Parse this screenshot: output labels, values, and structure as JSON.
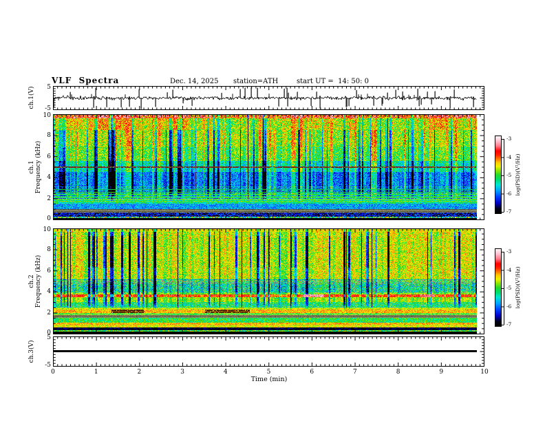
{
  "header": {
    "title": "VLF  Spectra",
    "date": "Dec. 14, 2025",
    "station": "station=ATH",
    "start_ut": "start UT =  14: 50: 0"
  },
  "axes": {
    "x": {
      "title": "Time (min)",
      "ticks": [
        "0",
        "1",
        "2",
        "3",
        "4",
        "5",
        "6",
        "7",
        "8",
        "9",
        "10"
      ],
      "tick_values": [
        0,
        1,
        2,
        3,
        4,
        5,
        6,
        7,
        8,
        9,
        10
      ],
      "range": [
        0,
        10
      ]
    },
    "wave1": {
      "label": "ch.1(V)",
      "ticks": [
        "5",
        "-5"
      ],
      "tick_values": [
        5,
        -5
      ],
      "range": [
        -5,
        5
      ]
    },
    "spec1": {
      "label_line1": "ch.1",
      "label_line2": "Frequency (kHz)",
      "ticks": [
        "10",
        "8",
        "6",
        "4",
        "2",
        "0"
      ],
      "tick_values": [
        10,
        8,
        6,
        4,
        2,
        0
      ],
      "range": [
        0,
        10
      ]
    },
    "spec2": {
      "label_line1": "ch.2",
      "label_line2": "Frequency (kHz)",
      "ticks": [
        "10",
        "8",
        "6",
        "4",
        "2",
        "0"
      ],
      "tick_values": [
        10,
        8,
        6,
        4,
        2,
        0
      ],
      "range": [
        0,
        10
      ]
    },
    "wave3": {
      "label": "ch.3(V)",
      "ticks": [
        "5",
        "-5"
      ],
      "tick_values": [
        5,
        -5
      ],
      "range": [
        -5,
        5
      ]
    }
  },
  "colorbar": {
    "label": "log(PSD)(V²/Hz)",
    "ticks": [
      "-3",
      "-4",
      "-5",
      "-6",
      "-7"
    ],
    "range": [
      -7,
      -3
    ],
    "stops": [
      [
        0,
        "#000000"
      ],
      [
        0.055,
        "#00001a"
      ],
      [
        0.13,
        "#0000c8"
      ],
      [
        0.21,
        "#0040ff"
      ],
      [
        0.29,
        "#00a0ff"
      ],
      [
        0.37,
        "#00e6d2"
      ],
      [
        0.44,
        "#00dd66"
      ],
      [
        0.5,
        "#28d828"
      ],
      [
        0.56,
        "#96e600"
      ],
      [
        0.61,
        "#f0f000"
      ],
      [
        0.66,
        "#ffc800"
      ],
      [
        0.71,
        "#ff7000"
      ],
      [
        0.76,
        "#ff2000"
      ],
      [
        0.81,
        "#ff0000"
      ],
      [
        0.88,
        "#ff8090"
      ],
      [
        0.94,
        "#ffc0d0"
      ],
      [
        1,
        "#fff2f2"
      ]
    ]
  },
  "chart_data": [
    {
      "type": "line",
      "name": "ch1_waveform",
      "ylabel": "ch.1(V)",
      "xlim": [
        0,
        10
      ],
      "ylim": [
        -5,
        5
      ],
      "data_end_min": 9.83,
      "noise_sigma_v": 0.5,
      "spike_rate": 0.1,
      "spike_amp_v": [
        1,
        5
      ],
      "description": "Broadband noise of roughly ±1 V about 0 V with frequent impulsive spikes reaching ±5 V over 0–9.83 min"
    },
    {
      "type": "heatmap",
      "name": "ch1_spectrogram",
      "ylabel": "ch.1 Frequency (kHz)",
      "xlim": [
        0,
        10
      ],
      "ylim": [
        0,
        10
      ],
      "zlabel": "log(PSD)(V²/Hz)",
      "zlim": [
        -7,
        -3
      ],
      "data_end_min": 9.83,
      "bands": [
        {
          "f": [
            9.72,
            10
          ],
          "v": -3.8,
          "n": 0.65,
          "slow": 0.9
        },
        {
          "f": [
            8.55,
            9.72
          ],
          "v": -4.5,
          "n": 0.5,
          "slow": 0.9
        },
        {
          "f": [
            7.0,
            8.55
          ],
          "v": -4.8,
          "n": 0.45
        },
        {
          "f": [
            5.6,
            7.0
          ],
          "v": -5.0,
          "n": 0.45
        },
        {
          "f": [
            4.55,
            5.6
          ],
          "v": -5.5,
          "n": 0.45
        },
        {
          "f": [
            3.2,
            4.55
          ],
          "v": -6.0,
          "n": 0.4
        },
        {
          "f": [
            2.55,
            3.2
          ],
          "v": -5.8,
          "n": 0.4,
          "rs": 0.3
        },
        {
          "f": [
            1.98,
            2.55
          ],
          "v": -5.55,
          "n": 0.45,
          "rs": 0.35
        },
        {
          "f": [
            1.52,
            1.98
          ],
          "v": -5.3,
          "n": 0.45
        },
        {
          "f": [
            0.98,
            1.52
          ],
          "v": -5.85,
          "n": 0.35
        },
        {
          "f": [
            0.62,
            0.98
          ],
          "gray": true
        },
        {
          "f": [
            0.2,
            0.62
          ],
          "v": -6.5,
          "n": 0.6
        },
        {
          "f": [
            0.12,
            0.2
          ],
          "v": -5.2,
          "n": 1.0
        },
        {
          "f": [
            0,
            0.12
          ],
          "v": -7,
          "n": 0.1
        }
      ],
      "row_lines": [
        {
          "f": 5.0,
          "color": "#782810"
        },
        {
          "f": 1.72,
          "v": -4.85
        },
        {
          "f": 1.9,
          "v": -4.75
        },
        {
          "f": 2.12,
          "v": -5.0
        },
        {
          "f": 2.36,
          "v": -5.05
        },
        {
          "f": 2.6,
          "v": -5.05
        },
        {
          "f": 2.84,
          "v": -5.15
        }
      ],
      "stripes": {
        "dark_p": 0.3,
        "dark_amp": [
          0.5,
          1.7
        ],
        "bright_p": 0.2,
        "bright_amp": [
          0.3,
          0.8
        ],
        "black_p": 0.06,
        "fmin": 1.6,
        "ffull": 2.7,
        "fdamp": 8.55,
        "damp": 0.55
      },
      "description": "Green/yellow above ~5.5 kHz with red speckle near 10 kHz, dense vertical blue dropout stripes, blue low-power region 2–5.5 kHz with thin cyan horizontal lines near 1.7–2.9 kHz, brown line at 5 kHz, olive-gray band near 0.8 kHz, black band at 0 kHz"
    },
    {
      "type": "heatmap",
      "name": "ch2_spectrogram",
      "ylabel": "ch.2 Frequency (kHz)",
      "xlim": [
        0,
        10
      ],
      "ylim": [
        0,
        10
      ],
      "zlabel": "log(PSD)(V²/Hz)",
      "zlim": [
        -7,
        -3
      ],
      "data_end_min": 9.83,
      "bands": [
        {
          "f": [
            9.8,
            10
          ],
          "v": -4.55,
          "n": 0.3
        },
        {
          "f": [
            5.25,
            9.8
          ],
          "v": -4.7,
          "n": 0.4
        },
        {
          "f": [
            4.82,
            5.25
          ],
          "v": -5.2,
          "n": 0.5,
          "rs": 0.45
        },
        {
          "f": [
            3.92,
            4.82
          ],
          "v": -5.45,
          "n": 0.5,
          "rs": 0.3
        },
        {
          "f": [
            3.72,
            3.92
          ],
          "v": -4.9,
          "n": 0.35
        },
        {
          "f": [
            3.5,
            3.72
          ],
          "v": -4.05,
          "n": 0.35
        },
        {
          "f": [
            3.02,
            3.5
          ],
          "v": -4.85,
          "n": 0.35
        },
        {
          "f": [
            2.48,
            3.02
          ],
          "v": -5.25,
          "n": 0.4,
          "rs": 0.25
        },
        {
          "f": [
            2.26,
            2.48
          ],
          "v": -4.65,
          "n": 0.3
        },
        {
          "f": [
            1.95,
            2.26
          ],
          "v": -4.35,
          "n": 0.3
        },
        {
          "f": [
            1.73,
            1.95
          ],
          "v": -4.75,
          "n": 0.3
        },
        {
          "f": [
            1.46,
            1.73
          ],
          "gray": true
        },
        {
          "f": [
            1.04,
            1.46
          ],
          "v": -5.1,
          "n": 0.4
        },
        {
          "f": [
            0.82,
            1.04
          ],
          "v": -4.35,
          "n": 0.3
        },
        {
          "f": [
            0.55,
            0.82
          ],
          "v": -4.55,
          "n": 0.35
        },
        {
          "f": [
            0.3,
            0.55
          ],
          "v": -6.8,
          "n": 0.3
        },
        {
          "f": [
            0.14,
            0.3
          ],
          "v": -5.0,
          "n": 0.5
        },
        {
          "f": [
            0,
            0.14
          ],
          "v": -7,
          "n": 0.1
        }
      ],
      "row_lines": [
        {
          "f": 1.84,
          "v": -5.3
        }
      ],
      "patches": [
        {
          "f": [
            1.97,
            2.22
          ],
          "t": [
            1.35,
            2.08
          ],
          "colors": [
            "#6b3800",
            "#3c2200",
            "#7a4200"
          ]
        },
        {
          "f": [
            1.97,
            2.22
          ],
          "t": [
            3.52,
            4.55
          ],
          "colors": [
            "#6b3800",
            "#3c2200",
            "#7a4200"
          ]
        }
      ],
      "hot_spots": [
        {
          "f": [
            3.5,
            3.72
          ],
          "t": [
            5.8,
            6.28
          ],
          "v": -3.35
        },
        {
          "f": [
            3.5,
            3.72
          ],
          "t": [
            8.52,
            8.85
          ],
          "v": -3.5
        }
      ],
      "stripes": {
        "dark_p": 0.2,
        "dark_amp": [
          0.7,
          2.0
        ],
        "bright_p": 0.2,
        "bright_amp": [
          0.05,
          0.3
        ],
        "black_p": 0.25,
        "fmin": 2.3,
        "ffull": 3.2,
        "fdamp": 9.8,
        "damp": 0.4,
        "blob_f": [
          6.3,
          9.4
        ],
        "blob_extra": 0.6
      },
      "description": "Mostly green with narrow black/deep-blue vertical dropout stripes above ~2.3 kHz, orange-red line at ~3.6 kHz with red blobs near 5.8–6.3 and 8.5–8.9 min, yellow bands near 0.9 and 2.1 kHz with dark-brown patches at 1.4–2.1 and 3.5–4.6 min, olive-gray band near 1.6 kHz, black bands near 0.4 kHz and 0 kHz"
    },
    {
      "type": "line",
      "name": "ch3_waveform",
      "ylabel": "ch.3(V)",
      "xlim": [
        0,
        10
      ],
      "ylim": [
        -5,
        5
      ],
      "value_v": 0,
      "data_end_min": 9.83,
      "description": "Constant 0 V thick black trace (no signal) ending at ~9.83 min"
    }
  ]
}
